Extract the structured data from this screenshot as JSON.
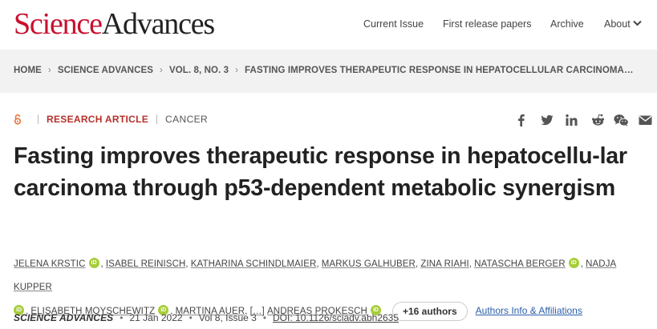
{
  "header": {
    "logo_part1": "Science",
    "logo_part2": "Advances",
    "nav": {
      "current_issue": "Current Issue",
      "first_release": "First release papers",
      "archive": "Archive",
      "about": "About"
    }
  },
  "breadcrumb": [
    "HOME",
    "SCIENCE ADVANCES",
    "VOL. 8, NO. 3",
    "FASTING IMPROVES THERAPEUTIC RESPONSE IN HEPATOCELLULAR CARCINOMA…"
  ],
  "article": {
    "type": "RESEARCH ARTICLE",
    "subject": "CANCER",
    "title": "Fasting improves therapeutic response in hepatocellu-lar carcinoma through p53-dependent metabolic synergism",
    "authors": {
      "a1": "Jelena Krstic",
      "a2": "Isabel Reinisch",
      "a3": "Katharina Schindlmaier",
      "a4": "Markus Galhuber",
      "a5": "Zina Riahi",
      "a6": "Natascha Berger",
      "a7": "Nadja Kupper",
      "a8": "Elisabeth Moyschewitz",
      "a9": "Martina Auer",
      "ellipsis": "[…]",
      "a10": "Andreas Prokesch",
      "orcid_label": "iD",
      "more_authors": "+16 authors",
      "affiliations_link": "Authors Info & Affiliations"
    },
    "citation": {
      "journal": "SCIENCE ADVANCES",
      "date": "21 Jan 2022",
      "volume": "Vol 8, Issue 3",
      "doi": "DOI: 10.1126/sciadv.abh2635"
    }
  },
  "colors": {
    "brand_red": "#c8102e",
    "type_red": "#b5302a",
    "orcid_green": "#a6ce39",
    "link_blue": "#2a5ea8",
    "breadcrumb_bg": "#f2f2f2"
  },
  "share_icons": [
    "facebook-icon",
    "twitter-icon",
    "linkedin-icon",
    "reddit-icon",
    "wechat-icon",
    "email-icon"
  ]
}
